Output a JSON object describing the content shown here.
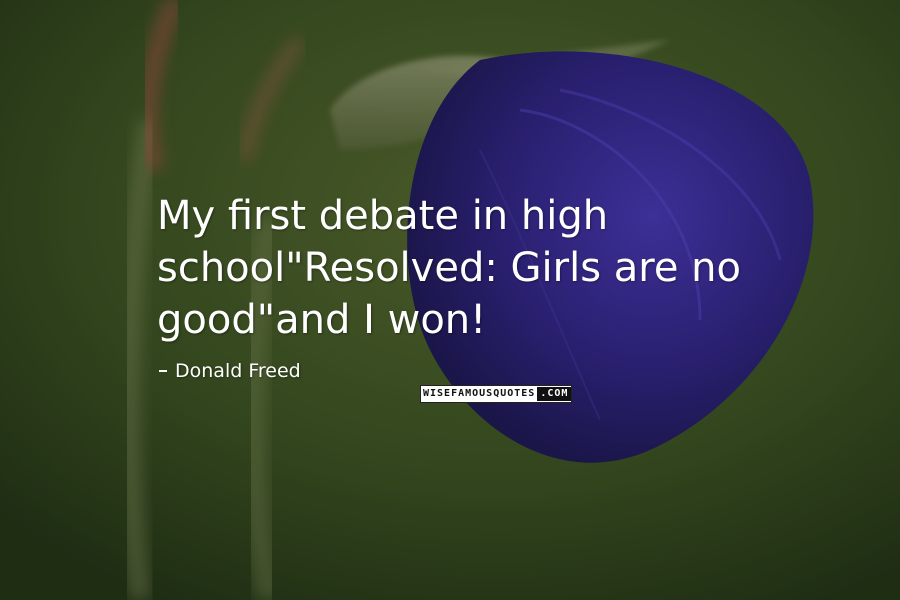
{
  "quote": {
    "text": "My first debate in high school\"Resolved: Girls are no good\"and I won!",
    "author": "Donald Freed"
  },
  "brand": {
    "part_a": "WISEFAMOUSQUOTES",
    "part_b": ".COM"
  },
  "colors": {
    "background": "#3f5a24",
    "flower": "#3a2f9a",
    "text": "#ffffff"
  },
  "icons": {
    "author_marker": "dash-icon"
  }
}
